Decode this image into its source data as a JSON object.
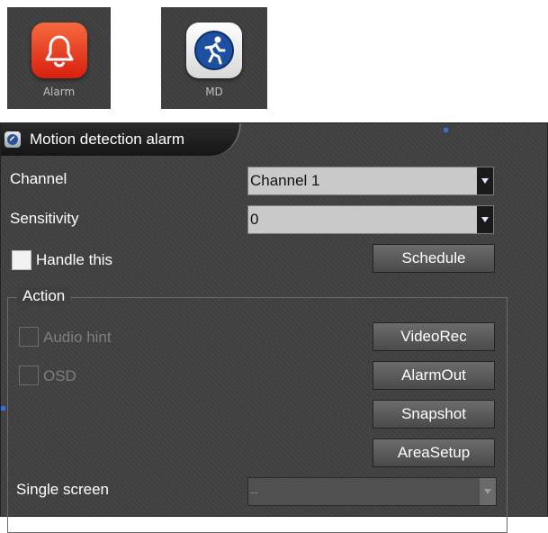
{
  "tiles": [
    {
      "label": "Alarm",
      "icon": "bell-icon"
    },
    {
      "label": "MD",
      "icon": "running-man-icon"
    }
  ],
  "dialog": {
    "title": "Motion detection alarm",
    "title_icon": "globe-icon"
  },
  "channel": {
    "label": "Channel",
    "value": "Channel 1"
  },
  "sensitivity": {
    "label": "Sensitivity",
    "value": "0"
  },
  "handle": {
    "label": "Handle this",
    "checked": false
  },
  "schedule_button": "Schedule",
  "action": {
    "legend": "Action",
    "audio_hint": {
      "label": "Audio hint",
      "enabled": false,
      "checked": false
    },
    "osd": {
      "label": "OSD",
      "enabled": false,
      "checked": false
    },
    "buttons": {
      "videorec": "VideoRec",
      "alarmout": "AlarmOut",
      "snapshot": "Snapshot",
      "areasetup": "AreaSetup"
    },
    "single_screen": {
      "label": "Single screen",
      "value": "--",
      "enabled": false
    }
  },
  "colors": {
    "panel_bg": "#3f3f3f",
    "alarm_icon": "#e8401f",
    "md_icon_blue": "#1e4fa0",
    "selection_marker": "#3a6fd8"
  }
}
